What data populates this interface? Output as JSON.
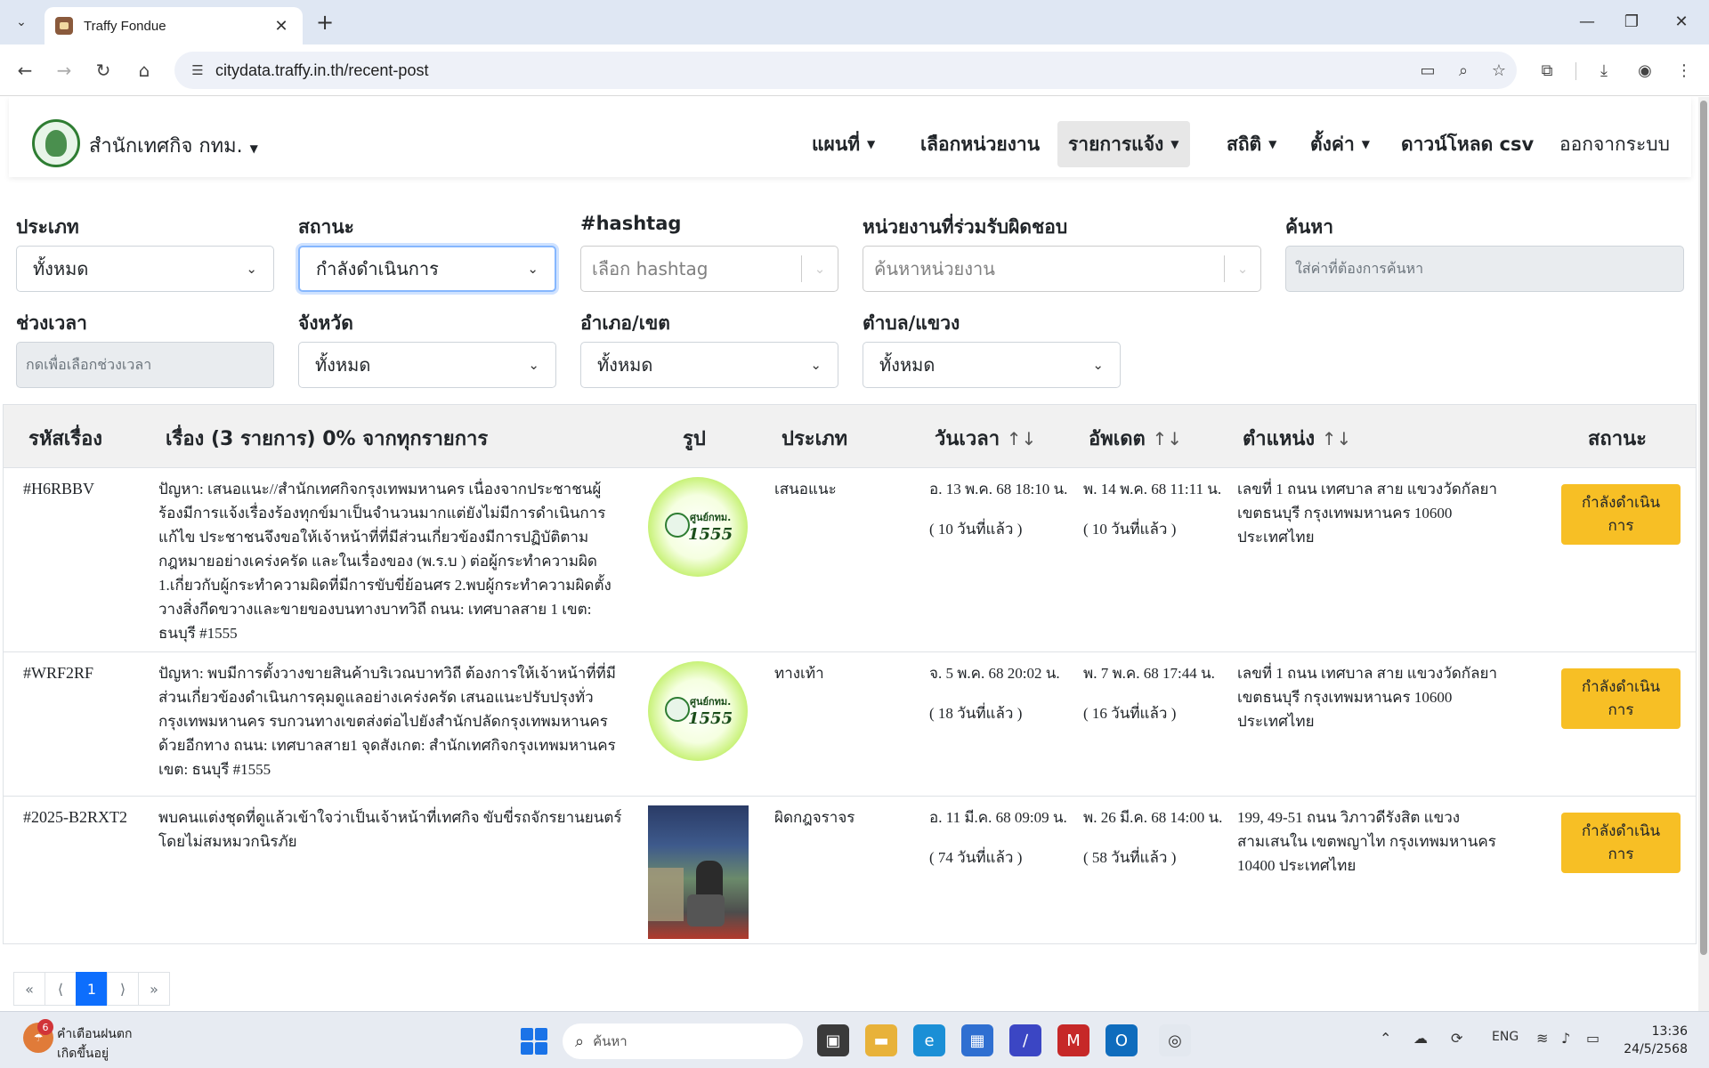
{
  "browser": {
    "tab_title": "Traffy Fondue",
    "url": "citydata.traffy.in.th/recent-post"
  },
  "navbar": {
    "brand": "สำนักเทศกิจ กทม.",
    "menu": [
      "แผนที่",
      "เลือกหน่วยงาน",
      "รายการแจ้ง",
      "สถิติ",
      "ตั้งค่า",
      "ดาวน์โหลด csv",
      "ออกจากระบบ"
    ]
  },
  "filters": {
    "type_label": "ประเภท",
    "type_value": "ทั้งหมด",
    "status_label": "สถานะ",
    "status_value": "กำลังดำเนินการ",
    "hashtag_label": "#hashtag",
    "hashtag_placeholder": "เลือก hashtag",
    "agency_label": "หน่วยงานที่ร่วมรับผิดชอบ",
    "agency_placeholder": "ค้นหาหน่วยงาน",
    "search_label": "ค้นหา",
    "search_placeholder": "ใส่ค่าที่ต้องการค้นหา",
    "time_label": "ช่วงเวลา",
    "time_placeholder": "กดเพื่อเลือกช่วงเวลา",
    "province_label": "จังหวัด",
    "province_value": "ทั้งหมด",
    "district_label": "อำเภอ/เขต",
    "district_value": "ทั้งหมด",
    "subdistrict_label": "ตำบล/แขวง",
    "subdistrict_value": "ทั้งหมด"
  },
  "table": {
    "headers": {
      "id": "รหัสเรื่อง",
      "title": "เรื่อง (3 รายการ) 0% จากทุกรายการ",
      "image": "รูป",
      "type": "ประเภท",
      "datetime": "วันเวลา",
      "updated": "อัพเดต",
      "location": "ตำแหน่ง",
      "status": "สถานะ"
    },
    "sort_icon": "↑↓",
    "rows": [
      {
        "id": "#H6RBBV",
        "title": "ปัญหา: เสนอแนะ//สำนักเทศกิจกรุงเทพมหานคร เนื่องจากประชาชนผู้ร้องมีการแจ้งเรื่องร้องทุกข์มาเป็นจำนวนมากแต่ยังไม่มีการดำเนินการแก้ไข ประชาชนจึงขอให้เจ้าหน้าที่ที่มีส่วนเกี่ยวข้องมีการปฏิบัติตามกฎหมายอย่างเคร่งครัด และในเรื่องของ (พ.ร.บ ) ต่อผู้กระทำความผิด 1.เกี่ยวกับผู้กระทำความผิดที่มีการขับขี่ย้อนศร 2.พบผู้กระทำความผิดตั้งวางสิ่งกีดขวางและขายของบนทางบาทวิถี ถนน: เทศบาลสาย 1 เขต: ธนบุรี #1555",
        "image_text_1": "ศูนย์กทม.",
        "image_text_2": "1555",
        "type": "เสนอแนะ",
        "datetime": "อ. 13 พ.ค. 68 18:10 น.",
        "datetime_ago": "( 10 วันที่แล้ว )",
        "updated": "พ. 14 พ.ค. 68 11:11 น.",
        "updated_ago": "( 10 วันที่แล้ว )",
        "location": "เลขที่ 1 ถนน เทศบาล สาย แขวงวัดกัลยา เขตธนบุรี กรุงเทพมหานคร 10600 ประเทศไทย",
        "status": "กำลังดำเนินการ"
      },
      {
        "id": "#WRF2RF",
        "title": "ปัญหา: พบมีการตั้งวางขายสินค้าบริเวณบาทวิถี ต้องการให้เจ้าหน้าที่ที่มีส่วนเกี่ยวข้องดำเนินการคุมดูแลอย่างเคร่งครัด เสนอแนะปรับปรุงทั่วกรุงเทพมหานคร รบกวนทางเขตส่งต่อไปยังสำนักปลัดกรุงเทพมหานครด้วยอีกทาง ถนน: เทศบาลสาย1 จุดสังเกต: สำนักเทศกิจกรุงเทพมหานคร เขต: ธนบุรี #1555",
        "image_text_1": "ศูนย์กทม.",
        "image_text_2": "1555",
        "type": "ทางเท้า",
        "datetime": "จ. 5 พ.ค. 68 20:02 น.",
        "datetime_ago": "( 18 วันที่แล้ว )",
        "updated": "พ. 7 พ.ค. 68 17:44 น.",
        "updated_ago": "( 16 วันที่แล้ว )",
        "location": "เลขที่ 1 ถนน เทศบาล สาย แขวงวัดกัลยา เขตธนบุรี กรุงเทพมหานคร 10600 ประเทศไทย",
        "status": "กำลังดำเนินการ"
      },
      {
        "id": "#2025-B2RXT2",
        "title": "พบคนแต่งชุดที่ดูแล้วเข้าใจว่าเป็นเจ้าหน้าที่เทศกิจ ขับขี่รถจักรยานยนตร์โดยไม่สมหมวกนิรภัย",
        "type": "ผิดกฎจราจร",
        "datetime": "อ. 11 มี.ค. 68 09:09 น.",
        "datetime_ago": "( 74 วันที่แล้ว )",
        "updated": "พ. 26 มี.ค. 68 14:00 น.",
        "updated_ago": "( 58 วันที่แล้ว )",
        "location": "199, 49-51 ถนน วิภาวดีรังสิต แขวงสามเสนใน เขตพญาไท กรุงเทพมหานคร 10400 ประเทศไทย",
        "status": "กำลังดำเนินการ"
      }
    ]
  },
  "pagination": {
    "first": "«",
    "prev": "⟨",
    "current": "1",
    "next": "⟩",
    "last": "»"
  },
  "taskbar": {
    "notif_count": "6",
    "notif_title": "คำเตือนฝนตก",
    "notif_sub": "เกิดขึ้นอยู่",
    "search_placeholder": "ค้นหา",
    "lang": "ENG",
    "time": "13:36",
    "date": "24/5/2568"
  },
  "colors": {
    "status_button": "#f7bf25",
    "pagination_active": "#0d6efd",
    "browser_frame": "#dfe7f3"
  }
}
